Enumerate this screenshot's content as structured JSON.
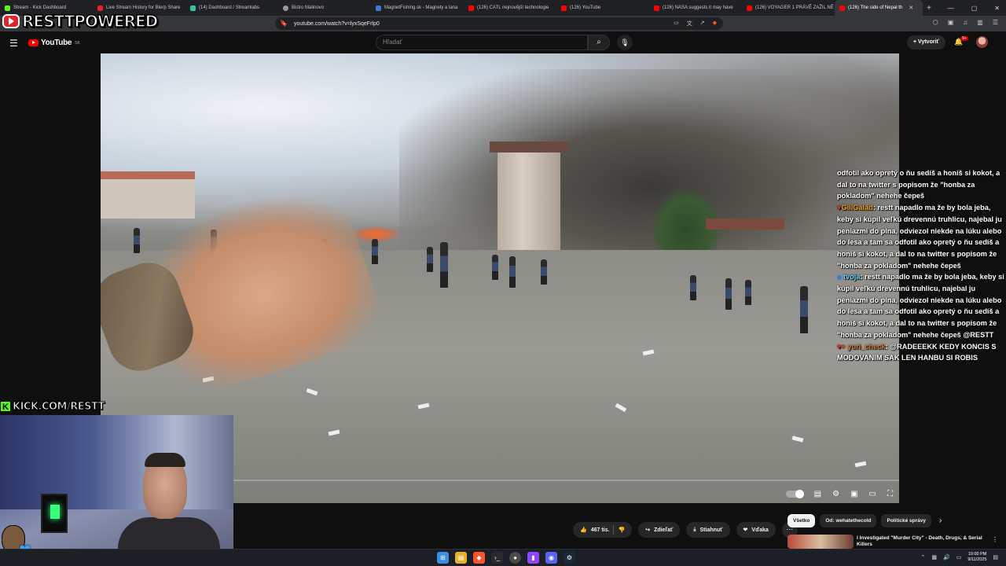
{
  "browser": {
    "tabs": [
      {
        "title": "Stream - Kick Dashboard",
        "color": "#53fc18"
      },
      {
        "title": "Live Stream History for Blerp Share",
        "color": "#e5212a"
      },
      {
        "title": "(14) Dashboard / Streamlabs",
        "color": "#31c3a2"
      },
      {
        "title": "Bistro Malinovo",
        "color": "#9a9a9a"
      },
      {
        "title": "MagnetFishing.sk - Magnety a lana",
        "color": "#3a7bd5"
      },
      {
        "title": "(126) CATL nejnovější technologie",
        "color": "#ff0000"
      },
      {
        "title": "(126) YouTube",
        "color": "#ff0000"
      },
      {
        "title": "(126) NASA suggests it may have",
        "color": "#ff0000"
      },
      {
        "title": "(126) VOYAGER 1 PRÁVĚ ZAŽIL NĚ",
        "color": "#ff0000"
      },
      {
        "title": "(126) The side of Nepal th",
        "color": "#ff0000",
        "active": true
      }
    ],
    "new_tab": "+",
    "url": "youtube.com/watch?v=lyxSqeFrlp0"
  },
  "youtube": {
    "logo_text": "YouTube",
    "region": "SK",
    "search_placeholder": "Hľadať",
    "create_label": "Vytvoriť",
    "notification_count": "9+"
  },
  "video": {
    "progress": 0.0
  },
  "chat": [
    {
      "user": "",
      "text": "odfotil ako opretý o ňu sedíš a honíš si kokot, a dal to na twitter s popisom že \"honba za pokladom\" nehehe čepeš"
    },
    {
      "user": "GillGalad",
      "user_color": "#f0a020",
      "badge": "heart",
      "text": "restt napadlo ma že by bola jeba, keby si kúpil veľkú drevennú truhlicu, najebal ju peniazmi do plna, odviezol niekde na lúku alebo do lesa a tam sa odfotil ako opretý o ňu sedíš a honíš si kokot, a dal to na twitter s popisom že \"honba za pokladom\" nehehe čepeš"
    },
    {
      "user": "tvoja",
      "user_color": "#6ad0ff",
      "badge": "dot",
      "text": "restt napadlo ma že by bola jeba, keby si kúpil veľkú drevennú truhlicu, najebal ju peniazmi do plna, odviezol niekde na lúku alebo do lesa a tam sa odfotil ako opretý o ňu sedíš a honíš si kokot, a dal to na twitter s popisom že \"honba za pokladom\" nehehe čepeš @RESTT"
    },
    {
      "user": "yuri_check",
      "user_color": "#d07a3a",
      "badge": "heart",
      "text": "@RADEEEKK KEDY KONCIS S MODOVANIM SAK LEN HANBU SI ROBIS"
    }
  ],
  "overlay": {
    "brand": "RESTTPOWERED",
    "kick_letter": "K",
    "kick_url": "KICK.COM/RESTT"
  },
  "actions": {
    "likes": "467 tis.",
    "share": "Zdieľať",
    "download": "Stiahnuť",
    "thanks": "Vďaka",
    "more": "···"
  },
  "chips": [
    "Všetko",
    "Od: wehatethecold",
    "Politické správy"
  ],
  "recommended": {
    "title": "I Investigated \"Murder City\" - Death, Drugs, & Serial Killers"
  },
  "taskbar": {
    "time": "10:00 PM",
    "date": "9/11/2025"
  },
  "colors": {
    "youtube_red": "#ff0000",
    "kick_green": "#53fc18",
    "background": "#0f0f0f"
  }
}
